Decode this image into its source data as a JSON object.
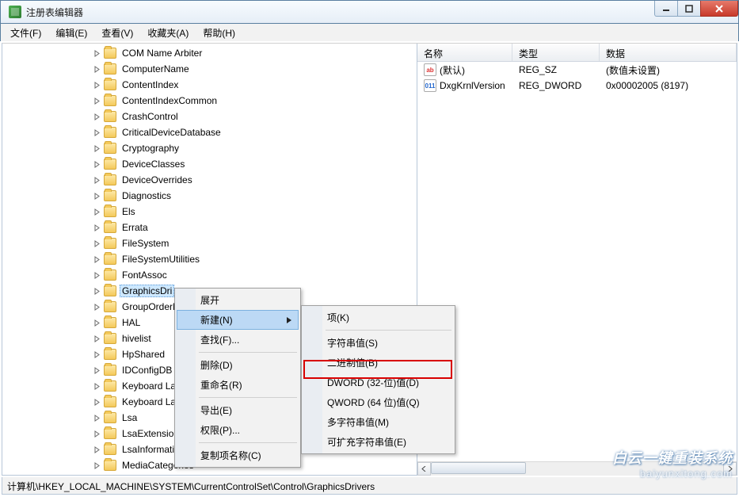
{
  "window": {
    "title": "注册表编辑器"
  },
  "menu": {
    "file": "文件(F)",
    "edit": "编辑(E)",
    "view": "查看(V)",
    "favorites": "收藏夹(A)",
    "help": "帮助(H)"
  },
  "tree": {
    "items": [
      "COM Name Arbiter",
      "ComputerName",
      "ContentIndex",
      "ContentIndexCommon",
      "CrashControl",
      "CriticalDeviceDatabase",
      "Cryptography",
      "DeviceClasses",
      "DeviceOverrides",
      "Diagnostics",
      "Els",
      "Errata",
      "FileSystem",
      "FileSystemUtilities",
      "FontAssoc",
      "GraphicsDrivers",
      "GroupOrderList",
      "HAL",
      "hivelist",
      "HpShared",
      "IDConfigDB",
      "Keyboard Layout",
      "Keyboard Layouts",
      "Lsa",
      "LsaExtensionConfig",
      "LsaInformation",
      "MediaCategories"
    ],
    "selected_index": 15,
    "selected_display": "GraphicsDri"
  },
  "list": {
    "cols": {
      "name": "名称",
      "type": "类型",
      "data": "数据"
    },
    "rows": [
      {
        "icon": "sz",
        "name": "(默认)",
        "type": "REG_SZ",
        "data": "(数值未设置)"
      },
      {
        "icon": "dw",
        "name": "DxgKrnlVersion",
        "type": "REG_DWORD",
        "data": "0x00002005 (8197)"
      }
    ]
  },
  "ctx1": {
    "expand": "展开",
    "new": "新建(N)",
    "find": "查找(F)...",
    "delete": "删除(D)",
    "rename": "重命名(R)",
    "export": "导出(E)",
    "perm": "权限(P)...",
    "copyname": "复制项名称(C)"
  },
  "ctx2": {
    "key": "项(K)",
    "string": "字符串值(S)",
    "binary": "二进制值(B)",
    "dword": "DWORD (32-位)值(D)",
    "qword": "QWORD (64 位)值(Q)",
    "multi": "多字符串值(M)",
    "expand": "可扩充字符串值(E)"
  },
  "status": "计算机\\HKEY_LOCAL_MACHINE\\SYSTEM\\CurrentControlSet\\Control\\GraphicsDrivers",
  "watermark": {
    "cn": "白云一键重装系统",
    "url": "baiyunxitong.com"
  }
}
